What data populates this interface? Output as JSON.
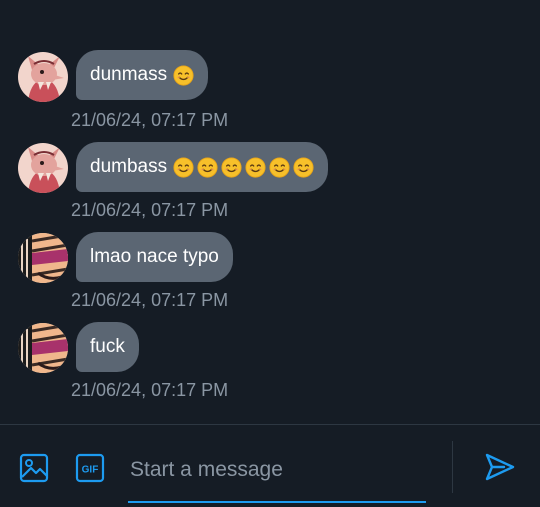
{
  "messages": [
    {
      "sender_avatar": "pink-cartoon-animal-avatar",
      "text": "dunmass",
      "emoji_count": 1,
      "timestamp": "21/06/24, 07:17 PM"
    },
    {
      "sender_avatar": "pink-cartoon-animal-avatar",
      "text": "dumbass",
      "emoji_count": 6,
      "timestamp": "21/06/24, 07:17 PM"
    },
    {
      "sender_avatar": "striped-character-avatar",
      "text": "lmao nace typo",
      "emoji_count": 0,
      "timestamp": "21/06/24, 07:17 PM"
    },
    {
      "sender_avatar": "striped-character-avatar",
      "text": "fuck",
      "emoji_count": 0,
      "timestamp": "21/06/24, 07:17 PM"
    }
  ],
  "composer": {
    "placeholder": "Start a message",
    "gif_label": "GIF",
    "media_icon": "image-icon",
    "send_icon": "send-icon"
  },
  "colors": {
    "background": "#151c25",
    "bubble": "#5b6673",
    "timestamp": "#8a96a3",
    "accent": "#1d9bf0"
  }
}
